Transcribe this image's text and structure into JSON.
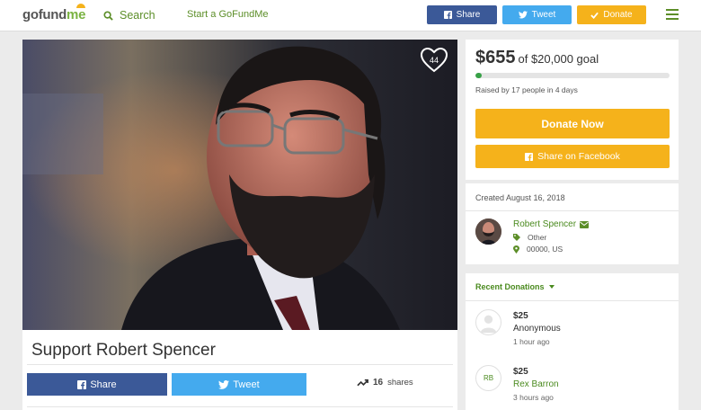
{
  "header": {
    "logo": {
      "part1": "go",
      "part2": "fund",
      "part3": "me"
    },
    "search_label": "Search",
    "start_label": "Start a GoFundMe",
    "share_label": "Share",
    "tweet_label": "Tweet",
    "donate_label": "Donate"
  },
  "campaign": {
    "title": "Support Robert Spencer",
    "heart_count": "44",
    "share_label": "Share",
    "tweet_label": "Tweet",
    "shares_count": "16",
    "shares_suffix": "shares"
  },
  "donation": {
    "amount": "$655",
    "goal_text": "of $20,000 goal",
    "progress_fraction": 0.0328,
    "raised_by": "Raised by 17 people in 4 days",
    "donate_now_label": "Donate Now",
    "share_facebook_label": "Share on Facebook"
  },
  "organizer": {
    "created": "Created August 16, 2018",
    "name": "Robert Spencer",
    "category": "Other",
    "location": "00000, US"
  },
  "recent": {
    "heading": "Recent Donations",
    "items": [
      {
        "amount": "$25",
        "name": "Anonymous",
        "time": "1 hour ago",
        "avatar": "person-icon"
      },
      {
        "amount": "$25",
        "name": "Rex Barron",
        "time": "3 hours ago",
        "avatar_initials": "RB"
      }
    ]
  },
  "colors": {
    "brand_green": "#5c8e28",
    "facebook": "#3b5998",
    "twitter": "#44aaee",
    "donate": "#f5b21b",
    "progress": "#37a147"
  }
}
